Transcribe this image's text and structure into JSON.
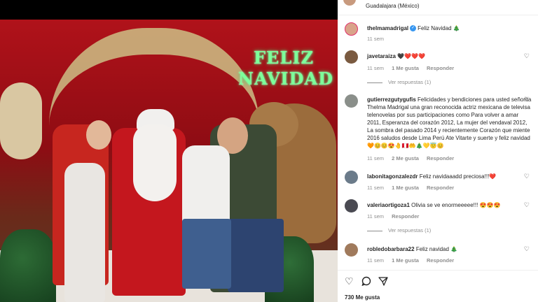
{
  "header": {
    "location": "Guadalajara (México)"
  },
  "photo": {
    "sign_line1": "FELIZ",
    "sign_line2": "NAVIDAD"
  },
  "caption": {
    "username": "thelmamadrigal",
    "text": "Feliz Navidad 🎄",
    "time": "11 sem"
  },
  "comments": [
    {
      "username": "javetaraiza",
      "text": "🖤❤️❤️❤️",
      "time": "11 sem",
      "likes": "1 Me gusta",
      "reply": "Responder",
      "view_replies": "Ver respuestas (1)"
    },
    {
      "username": "gutierrezgutygufis",
      "text": "Felicidades y bendiciones para usted señorita Thelma Madrigal una gran reconocida actriz mexicana de televisa telenovelas por sus participaciones como Para volver a amar 2011, Esperanza del corazón 2012, La mujer del vendaval 2012, La sombra del pasado 2014 y recientemente Corazón que miente 2016 saludos desde Lima Perú Ate Vitarte y suerte y feliz navidad 🧡😊😊😍🤚🇵🇪🤲🎄💛😇😊",
      "time": "11 sem",
      "likes": "2 Me gusta",
      "reply": "Responder"
    },
    {
      "username": "labonitagonzalezdr",
      "text": "Feliz navidaaadd preciosa!!!❤️",
      "time": "11 sem",
      "likes": "1 Me gusta",
      "reply": "Responder"
    },
    {
      "username": "valeriaortigoza1",
      "text": "Olivia se ve enormeeeee!!! 😍😍😍",
      "time": "11 sem",
      "reply": "Responder",
      "view_replies": "Ver respuestas (1)"
    },
    {
      "username": "robledobarbara22",
      "text": "Feliz navidad 🎄",
      "time": "11 sem",
      "likes": "1 Me gusta",
      "reply": "Responder"
    }
  ],
  "actions": {
    "like_icon": "heart-outline-icon",
    "comment_icon": "comment-icon",
    "share_icon": "share-icon",
    "likes_count": "730 Me gusta"
  },
  "colors": {
    "verified": "#3897f0",
    "secondary_text": "#8e8e8e",
    "sign_glow": "#7dff9a"
  }
}
